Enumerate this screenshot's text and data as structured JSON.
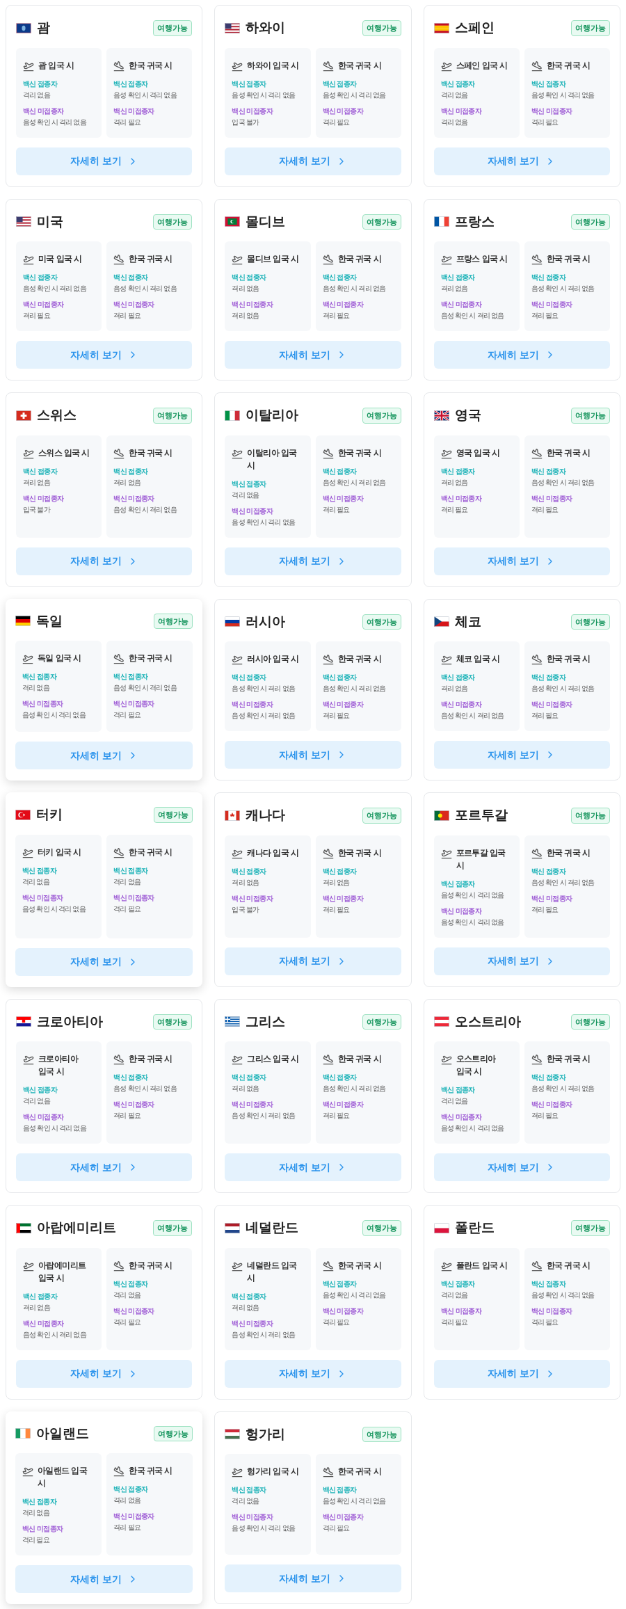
{
  "cards": [
    {
      "country": "괌",
      "badge": "여행가능",
      "hovered": false,
      "entry": {
        "title": "괌 입국 시",
        "vaccinated_label": "백신 접종자",
        "vaccinated": "격리 없음",
        "unvaccinated_label": "백신 미접종자",
        "unvaccinated": "음성 확인 시 격리 없음"
      },
      "return": {
        "title": "한국 귀국 시",
        "vaccinated_label": "백신 접종자",
        "vaccinated": "음성 확인 시 격리 없음",
        "unvaccinated_label": "백신 미접종자",
        "unvaccinated": "격리 필요"
      },
      "button": "자세히 보기"
    },
    {
      "country": "하와이",
      "badge": "여행가능",
      "hovered": false,
      "entry": {
        "title": "하와이 입국 시",
        "vaccinated_label": "백신 접종자",
        "vaccinated": "음성 확인 시 격리 없음",
        "unvaccinated_label": "백신 미접종자",
        "unvaccinated": "입국 불가"
      },
      "return": {
        "title": "한국 귀국 시",
        "vaccinated_label": "백신 접종자",
        "vaccinated": "음성 확인 시 격리 없음",
        "unvaccinated_label": "백신 미접종자",
        "unvaccinated": "격리 필요"
      },
      "button": "자세히 보기"
    },
    {
      "country": "스페인",
      "badge": "여행가능",
      "hovered": false,
      "entry": {
        "title": "스페인 입국 시",
        "vaccinated_label": "백신 접종자",
        "vaccinated": "격리 없음",
        "unvaccinated_label": "백신 미접종자",
        "unvaccinated": "격리 없음"
      },
      "return": {
        "title": "한국 귀국 시",
        "vaccinated_label": "백신 접종자",
        "vaccinated": "음성 확인 시 격리 없음",
        "unvaccinated_label": "백신 미접종자",
        "unvaccinated": "격리 필요"
      },
      "button": "자세히 보기"
    },
    {
      "country": "미국",
      "badge": "여행가능",
      "hovered": false,
      "entry": {
        "title": "미국 입국 시",
        "vaccinated_label": "백신 접종자",
        "vaccinated": "음성 확인 시 격리 없음",
        "unvaccinated_label": "백신 미접종자",
        "unvaccinated": "격리 필요"
      },
      "return": {
        "title": "한국 귀국 시",
        "vaccinated_label": "백신 접종자",
        "vaccinated": "음성 확인 시 격리 없음",
        "unvaccinated_label": "백신 미접종자",
        "unvaccinated": "격리 필요"
      },
      "button": "자세히 보기"
    },
    {
      "country": "몰디브",
      "badge": "여행가능",
      "hovered": false,
      "entry": {
        "title": "몰디브 입국 시",
        "vaccinated_label": "백신 접종자",
        "vaccinated": "격리 없음",
        "unvaccinated_label": "백신 미접종자",
        "unvaccinated": "격리 없음"
      },
      "return": {
        "title": "한국 귀국 시",
        "vaccinated_label": "백신 접종자",
        "vaccinated": "음성 확인 시 격리 없음",
        "unvaccinated_label": "백신 미접종자",
        "unvaccinated": "격리 필요"
      },
      "button": "자세히 보기"
    },
    {
      "country": "프랑스",
      "badge": "여행가능",
      "hovered": false,
      "entry": {
        "title": "프랑스 입국 시",
        "vaccinated_label": "백신 접종자",
        "vaccinated": "격리 없음",
        "unvaccinated_label": "백신 미접종자",
        "unvaccinated": "음성 확인 시 격리 없음"
      },
      "return": {
        "title": "한국 귀국 시",
        "vaccinated_label": "백신 접종자",
        "vaccinated": "음성 확인 시 격리 없음",
        "unvaccinated_label": "백신 미접종자",
        "unvaccinated": "격리 필요"
      },
      "button": "자세히 보기"
    },
    {
      "country": "스위스",
      "badge": "여행가능",
      "hovered": false,
      "entry": {
        "title": "스위스 입국 시",
        "vaccinated_label": "백신 접종자",
        "vaccinated": "격리 없음",
        "unvaccinated_label": "백신 미접종자",
        "unvaccinated": "입국 불가"
      },
      "return": {
        "title": "한국 귀국 시",
        "vaccinated_label": "백신 접종자",
        "vaccinated": "격리 없음",
        "unvaccinated_label": "백신 미접종자",
        "unvaccinated": "음성 확인 시 격리 없음"
      },
      "button": "자세히 보기"
    },
    {
      "country": "이탈리아",
      "badge": "여행가능",
      "hovered": false,
      "entry": {
        "title": "이탈리아 입국 시",
        "vaccinated_label": "백신 접종자",
        "vaccinated": "격리 없음",
        "unvaccinated_label": "백신 미접종자",
        "unvaccinated": "음성 확인 시 격리 없음"
      },
      "return": {
        "title": "한국 귀국 시",
        "vaccinated_label": "백신 접종자",
        "vaccinated": "음성 확인 시 격리 없음",
        "unvaccinated_label": "백신 미접종자",
        "unvaccinated": "격리 필요"
      },
      "button": "자세히 보기"
    },
    {
      "country": "영국",
      "badge": "여행가능",
      "hovered": false,
      "entry": {
        "title": "영국 입국 시",
        "vaccinated_label": "백신 접종자",
        "vaccinated": "격리 없음",
        "unvaccinated_label": "백신 미접종자",
        "unvaccinated": "격리 필요"
      },
      "return": {
        "title": "한국 귀국 시",
        "vaccinated_label": "백신 접종자",
        "vaccinated": "음성 확인 시 격리 없음",
        "unvaccinated_label": "백신 미접종자",
        "unvaccinated": "격리 필요"
      },
      "button": "자세히 보기"
    },
    {
      "country": "독일",
      "badge": "여행가능",
      "hovered": true,
      "entry": {
        "title": "독일 입국 시",
        "vaccinated_label": "백신 접종자",
        "vaccinated": "격리 없음",
        "unvaccinated_label": "백신 미접종자",
        "unvaccinated": "음성 확인 시 격리 없음"
      },
      "return": {
        "title": "한국 귀국 시",
        "vaccinated_label": "백신 접종자",
        "vaccinated": "음성 확인 시 격리 없음",
        "unvaccinated_label": "백신 미접종자",
        "unvaccinated": "격리 필요"
      },
      "button": "자세히 보기"
    },
    {
      "country": "러시아",
      "badge": "여행가능",
      "hovered": false,
      "entry": {
        "title": "러시아 입국 시",
        "vaccinated_label": "백신 접종자",
        "vaccinated": "음성 확인 시 격리 없음",
        "unvaccinated_label": "백신 미접종자",
        "unvaccinated": "음성 확인 시 격리 없음"
      },
      "return": {
        "title": "한국 귀국 시",
        "vaccinated_label": "백신 접종자",
        "vaccinated": "음성 확인 시 격리 없음",
        "unvaccinated_label": "백신 미접종자",
        "unvaccinated": "격리 필요"
      },
      "button": "자세히 보기"
    },
    {
      "country": "체코",
      "badge": "여행가능",
      "hovered": false,
      "entry": {
        "title": "체코 입국 시",
        "vaccinated_label": "백신 접종자",
        "vaccinated": "격리 없음",
        "unvaccinated_label": "백신 미접종자",
        "unvaccinated": "음성 확인 시 격리 없음"
      },
      "return": {
        "title": "한국 귀국 시",
        "vaccinated_label": "백신 접종자",
        "vaccinated": "음성 확인 시 격리 없음",
        "unvaccinated_label": "백신 미접종자",
        "unvaccinated": "격리 필요"
      },
      "button": "자세히 보기"
    },
    {
      "country": "터키",
      "badge": "여행가능",
      "hovered": true,
      "entry": {
        "title": "터키 입국 시",
        "vaccinated_label": "백신 접종자",
        "vaccinated": "격리 없음",
        "unvaccinated_label": "백신 미접종자",
        "unvaccinated": "음성 확인 시 격리 없음"
      },
      "return": {
        "title": "한국 귀국 시",
        "vaccinated_label": "백신 접종자",
        "vaccinated": "격리 없음",
        "unvaccinated_label": "백신 미접종자",
        "unvaccinated": "격리 필요"
      },
      "button": "자세히 보기"
    },
    {
      "country": "캐나다",
      "badge": "여행가능",
      "hovered": false,
      "entry": {
        "title": "캐나다 입국 시",
        "vaccinated_label": "백신 접종자",
        "vaccinated": "격리 없음",
        "unvaccinated_label": "백신 미접종자",
        "unvaccinated": "입국 불가"
      },
      "return": {
        "title": "한국 귀국 시",
        "vaccinated_label": "백신 접종자",
        "vaccinated": "격리 없음",
        "unvaccinated_label": "백신 미접종자",
        "unvaccinated": "격리 필요"
      },
      "button": "자세히 보기"
    },
    {
      "country": "포르투갈",
      "badge": "여행가능",
      "hovered": false,
      "entry": {
        "title": "포르투갈 입국 시",
        "vaccinated_label": "백신 접종자",
        "vaccinated": "음성 확인 시 격리 없음",
        "unvaccinated_label": "백신 미접종자",
        "unvaccinated": "음성 확인 시 격리 없음"
      },
      "return": {
        "title": "한국 귀국 시",
        "vaccinated_label": "백신 접종자",
        "vaccinated": "음성 확인 시 격리 없음",
        "unvaccinated_label": "백신 미접종자",
        "unvaccinated": "격리 필요"
      },
      "button": "자세히 보기"
    },
    {
      "country": "크로아티아",
      "badge": "여행가능",
      "hovered": false,
      "entry": {
        "title": "크로아티아 입국 시",
        "vaccinated_label": "백신 접종자",
        "vaccinated": "격리 없음",
        "unvaccinated_label": "백신 미접종자",
        "unvaccinated": "음성 확인 시 격리 없음"
      },
      "return": {
        "title": "한국 귀국 시",
        "vaccinated_label": "백신 접종자",
        "vaccinated": "음성 확인 시 격리 없음",
        "unvaccinated_label": "백신 미접종자",
        "unvaccinated": "격리 필요"
      },
      "button": "자세히 보기"
    },
    {
      "country": "그리스",
      "badge": "여행가능",
      "hovered": false,
      "entry": {
        "title": "그리스 입국 시",
        "vaccinated_label": "백신 접종자",
        "vaccinated": "격리 없음",
        "unvaccinated_label": "백신 미접종자",
        "unvaccinated": "음성 확인 시 격리 없음"
      },
      "return": {
        "title": "한국 귀국 시",
        "vaccinated_label": "백신 접종자",
        "vaccinated": "음성 확인 시 격리 없음",
        "unvaccinated_label": "백신 미접종자",
        "unvaccinated": "격리 필요"
      },
      "button": "자세히 보기"
    },
    {
      "country": "오스트리아",
      "badge": "여행가능",
      "hovered": false,
      "entry": {
        "title": "오스트리아 입국 시",
        "vaccinated_label": "백신 접종자",
        "vaccinated": "격리 없음",
        "unvaccinated_label": "백신 미접종자",
        "unvaccinated": "음성 확인 시 격리 없음"
      },
      "return": {
        "title": "한국 귀국 시",
        "vaccinated_label": "백신 접종자",
        "vaccinated": "음성 확인 시 격리 없음",
        "unvaccinated_label": "백신 미접종자",
        "unvaccinated": "격리 필요"
      },
      "button": "자세히 보기"
    },
    {
      "country": "아랍에미리트",
      "badge": "여행가능",
      "hovered": false,
      "entry": {
        "title": "아랍에미리트 입국 시",
        "vaccinated_label": "백신 접종자",
        "vaccinated": "격리 없음",
        "unvaccinated_label": "백신 미접종자",
        "unvaccinated": "음성 확인 시 격리 없음"
      },
      "return": {
        "title": "한국 귀국 시",
        "vaccinated_label": "백신 접종자",
        "vaccinated": "격리 없음",
        "unvaccinated_label": "백신 미접종자",
        "unvaccinated": "격리 필요"
      },
      "button": "자세히 보기"
    },
    {
      "country": "네덜란드",
      "badge": "여행가능",
      "hovered": false,
      "entry": {
        "title": "네덜란드 입국 시",
        "vaccinated_label": "백신 접종자",
        "vaccinated": "격리 없음",
        "unvaccinated_label": "백신 미접종자",
        "unvaccinated": "음성 확인 시 격리 없음"
      },
      "return": {
        "title": "한국 귀국 시",
        "vaccinated_label": "백신 접종자",
        "vaccinated": "음성 확인 시 격리 없음",
        "unvaccinated_label": "백신 미접종자",
        "unvaccinated": "격리 필요"
      },
      "button": "자세히 보기"
    },
    {
      "country": "폴란드",
      "badge": "여행가능",
      "hovered": false,
      "entry": {
        "title": "폴란드 입국 시",
        "vaccinated_label": "백신 접종자",
        "vaccinated": "격리 없음",
        "unvaccinated_label": "백신 미접종자",
        "unvaccinated": "격리 필요"
      },
      "return": {
        "title": "한국 귀국 시",
        "vaccinated_label": "백신 접종자",
        "vaccinated": "음성 확인 시 격리 없음",
        "unvaccinated_label": "백신 미접종자",
        "unvaccinated": "격리 필요"
      },
      "button": "자세히 보기"
    },
    {
      "country": "아일랜드",
      "badge": "여행가능",
      "hovered": true,
      "entry": {
        "title": "아일랜드 입국 시",
        "vaccinated_label": "백신 접종자",
        "vaccinated": "격리 없음",
        "unvaccinated_label": "백신 미접종자",
        "unvaccinated": "격리 필요"
      },
      "return": {
        "title": "한국 귀국 시",
        "vaccinated_label": "백신 접종자",
        "vaccinated": "격리 없음",
        "unvaccinated_label": "백신 미접종자",
        "unvaccinated": "격리 필요"
      },
      "button": "자세히 보기"
    },
    {
      "country": "헝가리",
      "badge": "여행가능",
      "hovered": false,
      "entry": {
        "title": "헝가리 입국 시",
        "vaccinated_label": "백신 접종자",
        "vaccinated": "격리 없음",
        "unvaccinated_label": "백신 미접종자",
        "unvaccinated": "음성 확인 시 격리 없음"
      },
      "return": {
        "title": "한국 귀국 시",
        "vaccinated_label": "백신 접종자",
        "vaccinated": "음성 확인 시 격리 없음",
        "unvaccinated_label": "백신 미접종자",
        "unvaccinated": "격리 필요"
      },
      "button": "자세히 보기"
    }
  ]
}
